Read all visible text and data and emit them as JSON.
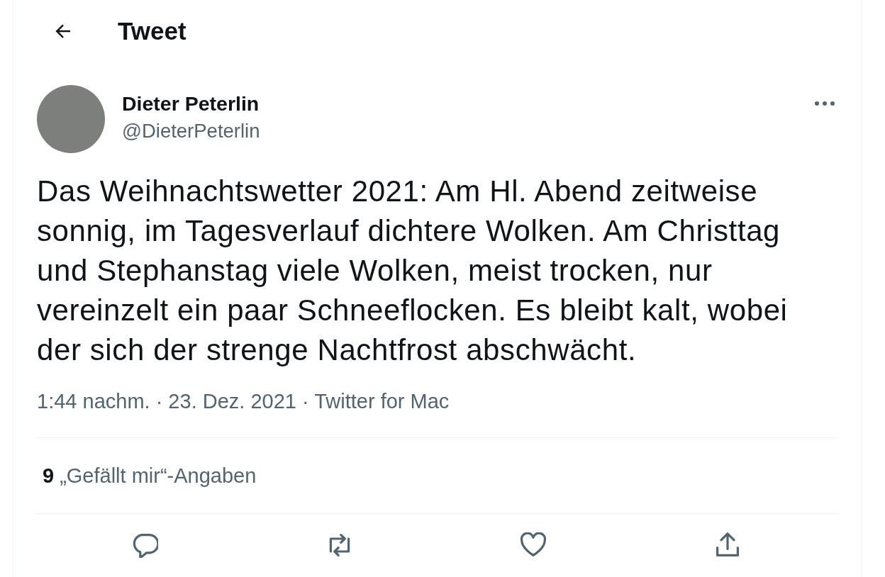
{
  "header": {
    "title": "Tweet"
  },
  "tweet": {
    "author_name": "Dieter Peterlin",
    "handle": "@DieterPeterlin",
    "text": "Das Weihnachtswetter 2021: Am Hl. Abend zeitweise sonnig, im Tagesverlauf dichtere Wolken. Am Christtag und Stephanstag viele Wolken, meist trocken, nur vereinzelt ein paar Schneeflocken. Es bleibt kalt, wobei der sich der strenge Nachtfrost abschwächt.",
    "meta": "1:44 nachm. · 23. Dez. 2021 · Twitter for Mac",
    "likes": {
      "count": "9",
      "label": "„Gefällt mir“-Angaben"
    },
    "actions": [
      {
        "kind": "reply"
      },
      {
        "kind": "retweet"
      },
      {
        "kind": "like"
      },
      {
        "kind": "share"
      }
    ]
  }
}
